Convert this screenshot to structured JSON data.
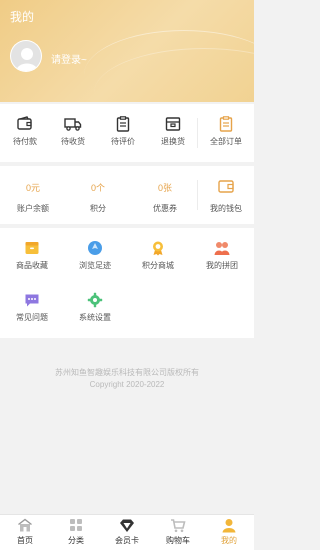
{
  "header": {
    "title": "我的",
    "login_prompt": "请登录~"
  },
  "orders": [
    {
      "label": "待付款",
      "icon": "wallet-icon"
    },
    {
      "label": "待收货",
      "icon": "truck-icon"
    },
    {
      "label": "待评价",
      "icon": "clipboard-icon"
    },
    {
      "label": "退换货",
      "icon": "return-box-icon"
    }
  ],
  "orders_all": {
    "label": "全部订单",
    "icon": "order-list-icon"
  },
  "wallet": [
    {
      "value": "0元",
      "label": "账户余额"
    },
    {
      "value": "0个",
      "label": "积分"
    },
    {
      "value": "0张",
      "label": "优惠券"
    }
  ],
  "wallet_entry": {
    "label": "我的钱包",
    "icon": "purse-icon"
  },
  "tools": [
    {
      "label": "商品收藏",
      "icon": "favorite-box-icon"
    },
    {
      "label": "浏览足迹",
      "icon": "footprint-icon"
    },
    {
      "label": "积分商城",
      "icon": "medal-icon"
    },
    {
      "label": "我的拼团",
      "icon": "group-icon"
    },
    {
      "label": "常见问题",
      "icon": "chat-question-icon"
    },
    {
      "label": "系统设置",
      "icon": "settings-gear-icon"
    }
  ],
  "footer": {
    "company": "苏州知鱼智趣娱乐科技有限公司版权所有",
    "copyright": "Copyright 2020-2022"
  },
  "tabbar": [
    {
      "label": "首页",
      "icon": "home-icon"
    },
    {
      "label": "分类",
      "icon": "category-grid-icon"
    },
    {
      "label": "会员卡",
      "icon": "diamond-icon"
    },
    {
      "label": "购物车",
      "icon": "cart-icon"
    },
    {
      "label": "我的",
      "icon": "user-icon",
      "active": true
    }
  ],
  "colors": {
    "accent": "#e6a34a",
    "header_gold": "#f0cc86",
    "active_tab": "#e0a23a"
  }
}
